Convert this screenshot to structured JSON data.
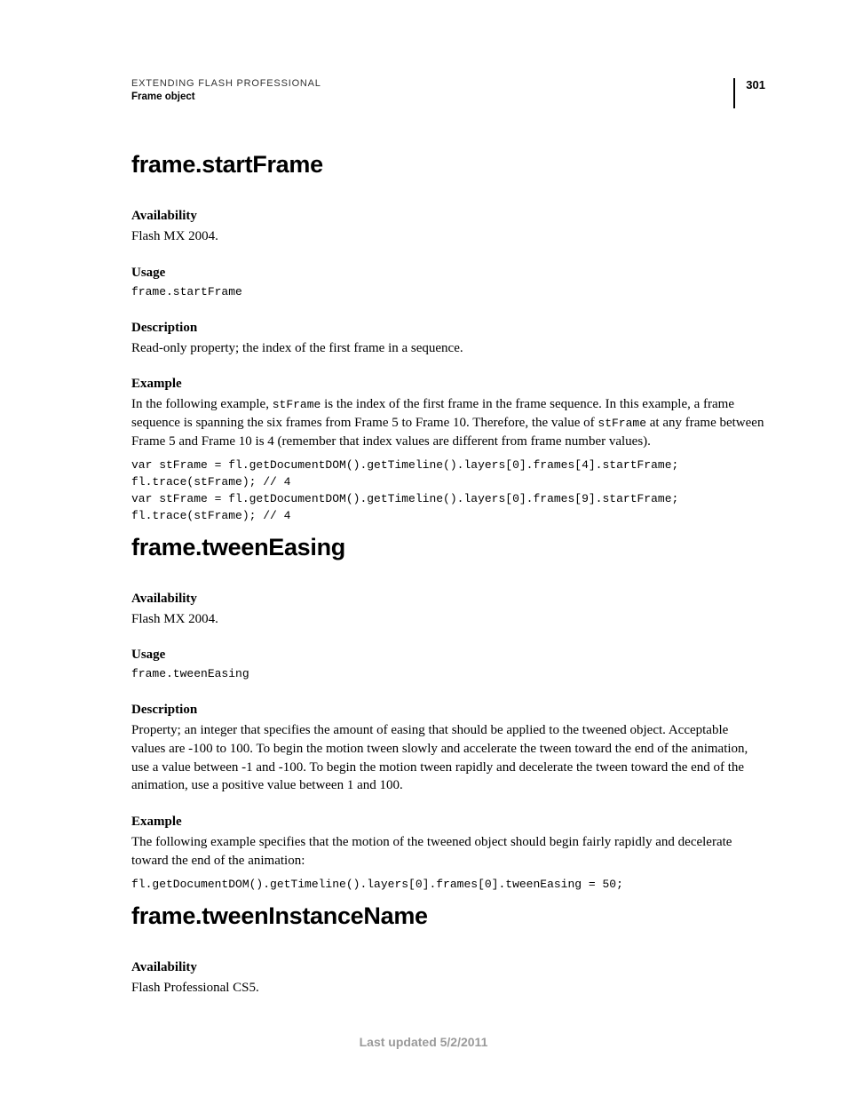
{
  "header": {
    "product": "EXTENDING FLASH PROFESSIONAL",
    "section": "Frame object",
    "page_number": "301"
  },
  "sections": [
    {
      "title": "frame.startFrame",
      "availability_label": "Availability",
      "availability_text": "Flash MX 2004.",
      "usage_label": "Usage",
      "usage_code": "frame.startFrame",
      "description_label": "Description",
      "description_text": "Read-only property; the index of the first frame in a sequence.",
      "example_label": "Example",
      "example_pre": "In the following example, ",
      "example_inline1": "stFrame",
      "example_mid1": " is the index of the first frame in the frame sequence. In this example, a frame sequence is spanning the six frames from Frame 5 to Frame 10. Therefore, the value of ",
      "example_inline2": "stFrame",
      "example_mid2": " at any frame between Frame 5 and Frame 10 is 4 (remember that index values are different from frame number values).",
      "example_code": "var stFrame = fl.getDocumentDOM().getTimeline().layers[0].frames[4].startFrame;\nfl.trace(stFrame); // 4\nvar stFrame = fl.getDocumentDOM().getTimeline().layers[0].frames[9].startFrame;\nfl.trace(stFrame); // 4"
    },
    {
      "title": "frame.tweenEasing",
      "availability_label": "Availability",
      "availability_text": "Flash MX 2004.",
      "usage_label": "Usage",
      "usage_code": "frame.tweenEasing",
      "description_label": "Description",
      "description_text": "Property; an integer that specifies the amount of easing that should be applied to the tweened object. Acceptable values are -100 to 100. To begin the motion tween slowly and accelerate the tween toward the end of the animation, use a value between -1 and -100. To begin the motion tween rapidly and decelerate the tween toward the end of the animation, use a positive value between 1 and 100.",
      "example_label": "Example",
      "example_text": "The following example specifies that the motion of the tweened object should begin fairly rapidly and decelerate toward the end of the animation:",
      "example_code": "fl.getDocumentDOM().getTimeline().layers[0].frames[0].tweenEasing = 50;"
    },
    {
      "title": "frame.tweenInstanceName",
      "availability_label": "Availability",
      "availability_text": "Flash Professional CS5."
    }
  ],
  "footer": "Last updated 5/2/2011"
}
